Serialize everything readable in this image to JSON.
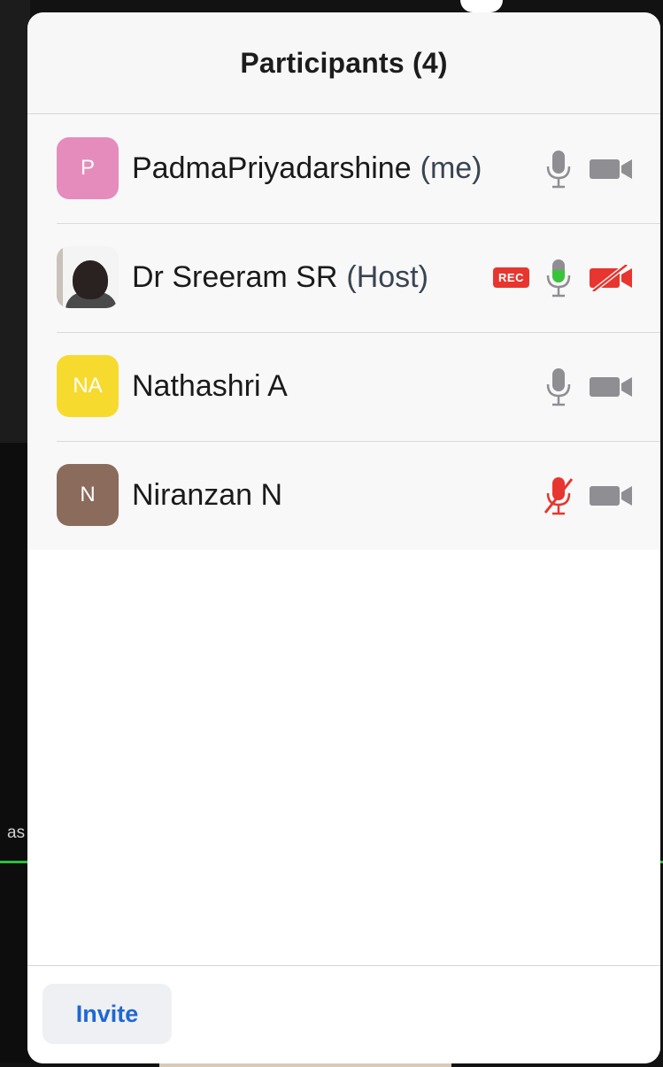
{
  "background": {
    "partial_text": "as"
  },
  "header": {
    "title": "Participants (4)"
  },
  "participants": [
    {
      "initials": "P",
      "name": "PadmaPriyadarshine",
      "suffix": "(me)",
      "avatar_color": "#e68cbc",
      "recording": false,
      "mic": "off",
      "video": "off"
    },
    {
      "initials": "",
      "name": "Dr Sreeram SR",
      "suffix": "(Host)",
      "avatar_color": "photo",
      "recording": true,
      "rec_label": "REC",
      "mic": "active",
      "video": "muted"
    },
    {
      "initials": "NA",
      "name": "Nathashri A",
      "suffix": "",
      "avatar_color": "#f6db2e",
      "recording": false,
      "mic": "off",
      "video": "off"
    },
    {
      "initials": "N",
      "name": "Niranzan N",
      "suffix": "",
      "avatar_color": "#8b6b5c",
      "recording": false,
      "mic": "muted",
      "video": "off"
    }
  ],
  "footer": {
    "invite_label": "Invite"
  },
  "colors": {
    "gray_icon": "#8e8e93",
    "green_active": "#3bc43b",
    "red_muted": "#e7362f",
    "accent_blue": "#1f67d2"
  }
}
